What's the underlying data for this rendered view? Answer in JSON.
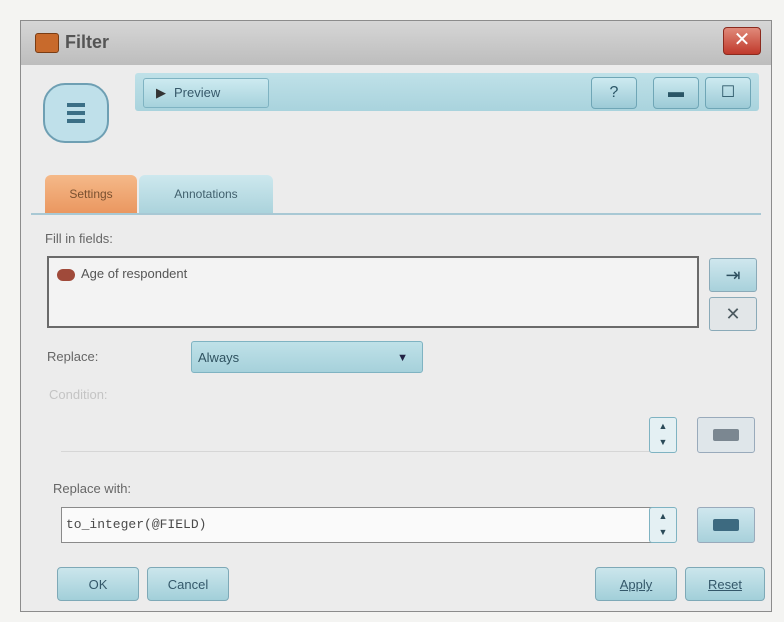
{
  "window": {
    "title": "Filter"
  },
  "toolbar": {
    "preview_label": "Preview",
    "help_icon": "help-icon",
    "minimize_icon": "minimize-icon",
    "maximize_icon": "maximize-icon"
  },
  "tabs": [
    {
      "label": "Settings",
      "active": true
    },
    {
      "label": "Annotations",
      "active": false
    }
  ],
  "filter": {
    "fields_label": "Fill in fields:",
    "fields": [
      "Age of respondent"
    ]
  },
  "replace": {
    "label": "Replace:",
    "value": "Always"
  },
  "condition": {
    "label": "Condition:",
    "value": ""
  },
  "replace_with": {
    "label": "Replace with:",
    "value": "to_integer(@FIELD)"
  },
  "buttons": {
    "ok": "OK",
    "cancel": "Cancel",
    "apply": "Apply",
    "reset": "Reset"
  },
  "colors": {
    "accent": "#a9d3dd",
    "active_tab": "#ea9760",
    "close": "#c0392b"
  }
}
